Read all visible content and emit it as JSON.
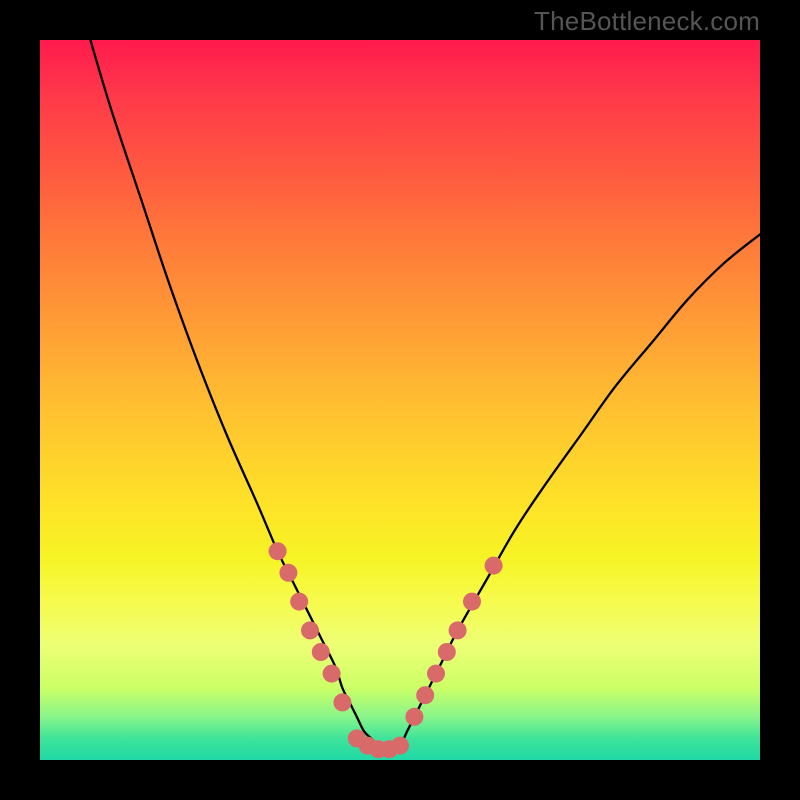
{
  "watermark": "TheBottleneck.com",
  "colors": {
    "dot": "#d96a6a",
    "curve": "#000000",
    "border": "#000000"
  },
  "chart_data": {
    "type": "line",
    "title": "",
    "xlabel": "",
    "ylabel": "",
    "xlim": [
      0,
      100
    ],
    "ylim": [
      0,
      100
    ],
    "grid": false,
    "legend": false,
    "series": [
      {
        "name": "bottleneck-curve",
        "x": [
          7,
          10,
          14,
          18,
          22,
          26,
          30,
          33,
          35,
          37,
          39,
          41,
          42,
          43,
          44,
          45,
          46,
          47,
          48,
          49,
          50,
          51,
          52,
          54,
          56,
          58,
          62,
          66,
          70,
          75,
          80,
          85,
          90,
          95,
          100
        ],
        "y": [
          100,
          90,
          78,
          66,
          55,
          45,
          36,
          29,
          25,
          21,
          17,
          13,
          10,
          8,
          6,
          4,
          3,
          2,
          1.5,
          1.5,
          2,
          4,
          6,
          10,
          14,
          18,
          25,
          32,
          38,
          45,
          52,
          58,
          64,
          69,
          73
        ]
      }
    ],
    "points": [
      {
        "name": "left-cluster-1",
        "x": 33,
        "y": 29
      },
      {
        "name": "left-cluster-2",
        "x": 34.5,
        "y": 26
      },
      {
        "name": "left-cluster-3",
        "x": 36,
        "y": 22
      },
      {
        "name": "left-cluster-4",
        "x": 37.5,
        "y": 18
      },
      {
        "name": "left-cluster-5",
        "x": 39,
        "y": 15
      },
      {
        "name": "left-cluster-6",
        "x": 40.5,
        "y": 12
      },
      {
        "name": "left-cluster-7",
        "x": 42,
        "y": 8
      },
      {
        "name": "valley-1",
        "x": 44,
        "y": 3
      },
      {
        "name": "valley-2",
        "x": 45.5,
        "y": 2
      },
      {
        "name": "valley-3",
        "x": 47,
        "y": 1.5
      },
      {
        "name": "valley-4",
        "x": 48.5,
        "y": 1.5
      },
      {
        "name": "valley-5",
        "x": 50,
        "y": 2
      },
      {
        "name": "right-cluster-1",
        "x": 52,
        "y": 6
      },
      {
        "name": "right-cluster-2",
        "x": 53.5,
        "y": 9
      },
      {
        "name": "right-cluster-3",
        "x": 55,
        "y": 12
      },
      {
        "name": "right-cluster-4",
        "x": 56.5,
        "y": 15
      },
      {
        "name": "right-cluster-5",
        "x": 58,
        "y": 18
      },
      {
        "name": "right-cluster-6",
        "x": 60,
        "y": 22
      },
      {
        "name": "right-outlier",
        "x": 63,
        "y": 27
      }
    ]
  }
}
